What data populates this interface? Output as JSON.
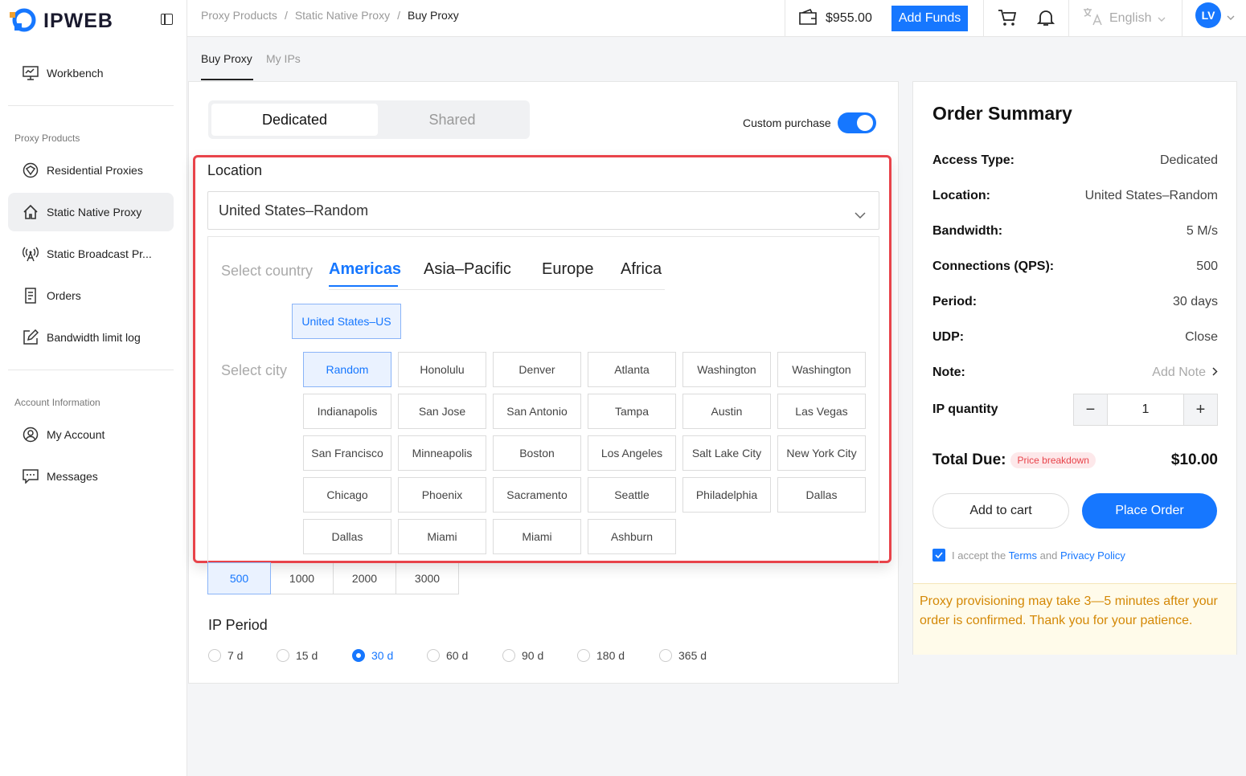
{
  "brand": {
    "name": "IPWEB"
  },
  "sidebar": {
    "items": [
      {
        "label": "Workbench",
        "icon": "monitor-icon"
      },
      {
        "label": "Residential Proxies",
        "icon": "globe-icon"
      },
      {
        "label": "Static Native Proxy",
        "icon": "home-icon"
      },
      {
        "label": "Static Broadcast Pr...",
        "icon": "antenna-icon"
      },
      {
        "label": "Orders",
        "icon": "receipt-icon"
      },
      {
        "label": "Bandwidth limit log",
        "icon": "edit-icon"
      },
      {
        "label": "My Account",
        "icon": "user-icon"
      },
      {
        "label": "Messages",
        "icon": "message-icon"
      }
    ],
    "sections": {
      "proxy": "Proxy Products",
      "account": "Account Information"
    }
  },
  "topbar": {
    "breadcrumb": [
      "Proxy Products",
      "Static Native Proxy",
      "Buy Proxy"
    ],
    "balance": "$955.00",
    "add_funds": "Add Funds",
    "language": "English",
    "avatar": "LV"
  },
  "tabs": [
    "Buy Proxy",
    "My IPs"
  ],
  "access": {
    "dedicated": "Dedicated",
    "shared": "Shared",
    "custom_label": "Custom purchase"
  },
  "location": {
    "title": "Location",
    "value": "United States–Random",
    "select_country": "Select country",
    "regions": [
      "Americas",
      "Asia–Pacific",
      "Europe",
      "Africa"
    ],
    "country": "United States–US",
    "select_city": "Select city",
    "cities": [
      "Random",
      "Honolulu",
      "Denver",
      "Atlanta",
      "Washington",
      "Washington",
      "Indianapolis",
      "San Jose",
      "San Antonio",
      "Tampa",
      "Austin",
      "Las Vegas",
      "San Francisco",
      "Minneapolis",
      "Boston",
      "Los Angeles",
      "Salt Lake City",
      "New York City",
      "Chicago",
      "Phoenix",
      "Sacramento",
      "Seattle",
      "Philadelphia",
      "Dallas",
      "Dallas",
      "Miami",
      "Miami",
      "Ashburn"
    ]
  },
  "bandwidth_options": [
    "500",
    "1000",
    "2000",
    "3000"
  ],
  "period": {
    "title": "IP Period",
    "options": [
      "7 d",
      "15 d",
      "30 d",
      "60 d",
      "90 d",
      "180 d",
      "365 d"
    ]
  },
  "order": {
    "title": "Order Summary",
    "rows": [
      {
        "k": "Access Type:",
        "v": "Dedicated"
      },
      {
        "k": "Location:",
        "v": "United States–Random"
      },
      {
        "k": "Bandwidth:",
        "v": "5 M/s"
      },
      {
        "k": "Connections (QPS):",
        "v": "500"
      },
      {
        "k": "Period:",
        "v": "30 days"
      },
      {
        "k": "UDP:",
        "v": "Close"
      }
    ],
    "note_k": "Note:",
    "note_v": "Add Note",
    "qty_k": "IP quantity",
    "qty": "1",
    "total_k": "Total Due:",
    "price_breakdown": "Price breakdown",
    "total": "$10.00",
    "add_to_cart": "Add to cart",
    "place_order": "Place Order",
    "accept_prefix": "I accept the",
    "terms": "Terms",
    "and": "and",
    "privacy": "Privacy Policy",
    "notice": "Proxy provisioning may take 3—5 minutes after your order is confirmed. Thank you for your patience."
  },
  "colors": {
    "accent": "#1677ff",
    "highlight": "#e8434a"
  }
}
